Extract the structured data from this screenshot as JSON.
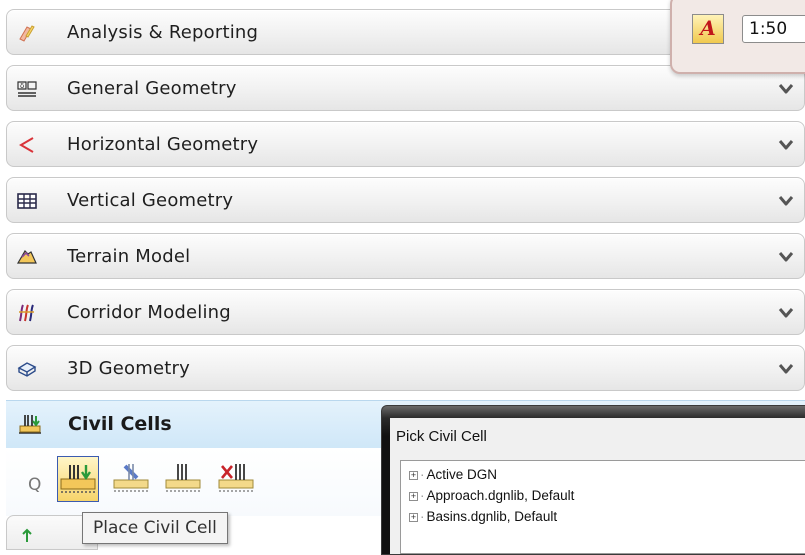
{
  "sections": [
    {
      "label": "Analysis & Reporting",
      "icon": "analysis-icon"
    },
    {
      "label": "General Geometry",
      "icon": "general-geometry-icon"
    },
    {
      "label": "Horizontal Geometry",
      "icon": "horizontal-geometry-icon"
    },
    {
      "label": "Vertical Geometry",
      "icon": "vertical-geometry-icon"
    },
    {
      "label": "Terrain Model",
      "icon": "terrain-model-icon"
    },
    {
      "label": "Corridor Modeling",
      "icon": "corridor-modeling-icon"
    },
    {
      "label": "3D Geometry",
      "icon": "3d-geometry-icon"
    }
  ],
  "civil_cells": {
    "label": "Civil Cells",
    "search_glyph": "Q",
    "tools": [
      "place-civil-cell-icon",
      "civil-cell-tool-2-icon",
      "civil-cell-tool-3-icon",
      "civil-cell-tool-4-icon"
    ],
    "tooltip": "Place Civil Cell"
  },
  "floating_toolbar": {
    "annotation_glyph": "A",
    "scale": "1:50"
  },
  "dialog": {
    "title": "Pick Civil Cell",
    "tree": [
      "Active DGN",
      "Approach.dgnlib, Default",
      "Basins.dgnlib, Default"
    ]
  }
}
